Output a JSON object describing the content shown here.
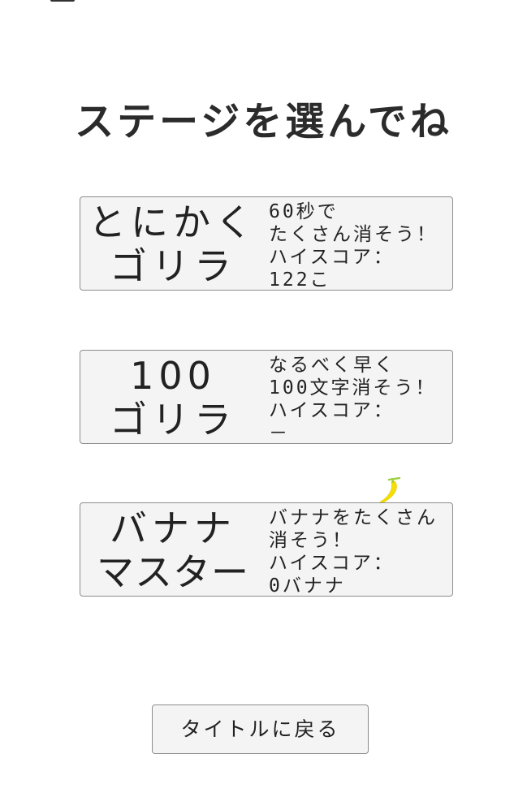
{
  "title": "ステージを選んでね",
  "stages": [
    {
      "name_lines": [
        "とにかく",
        "ゴリラ"
      ],
      "desc_lines": [
        "60秒で",
        "たくさん消そう！",
        "ハイスコア：",
        "122こ"
      ]
    },
    {
      "name_lines": [
        "100",
        "ゴリラ"
      ],
      "desc_lines": [
        "なるべく早く",
        "100文字消そう！",
        "ハイスコア：",
        "－"
      ]
    },
    {
      "name_lines": [
        "バナナ",
        "マスター"
      ],
      "desc_lines": [
        "バナナをたくさん",
        "消そう！",
        "ハイスコア：",
        "0バナナ"
      ]
    }
  ],
  "back_button": {
    "label": "タイトルに戻る"
  },
  "colors": {
    "banana": "#f5e000",
    "banana_stem": "#9bcf3a",
    "card_bg": "#f4f4f4",
    "card_border": "#8c8c8c"
  },
  "icons": {
    "decoration": "banana-icon"
  }
}
